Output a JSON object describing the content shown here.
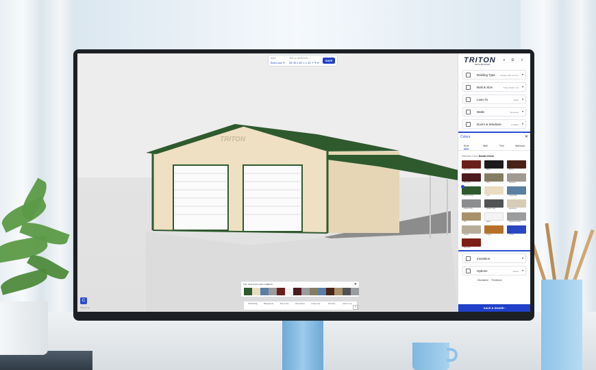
{
  "app": {
    "logo": "TRITON",
    "logo_sub": "METAL BUILDINGS",
    "side_icons": "⏸ ⚙ ⇪"
  },
  "topbar": {
    "style_label": "Style",
    "style_value": "Bolt-Lock ✎",
    "size_label": "Size & Dimension",
    "size_value": "26' W x 40' L x 12' T ✎ ▾",
    "save_label": "SAVE"
  },
  "menu": [
    {
      "label": "Building Type",
      "value": "Garage with Lean-to"
    },
    {
      "label": "Built & Size",
      "value": "Triple Width x 40"
    },
    {
      "label": "Lean-To",
      "value": "Right"
    },
    {
      "label": "Walls",
      "value": "Enclosed"
    },
    {
      "label": "Doors & Windows",
      "value": "2 Added"
    }
  ],
  "colors_panel": {
    "title": "Colors",
    "tabs": [
      "Roof",
      "Wall",
      "Trim",
      "Wainscot"
    ],
    "selected_prefix": "Selected Color:",
    "selected_value": "Hunter Green",
    "swatches": [
      {
        "name": "Barn Red",
        "color": "#6b1f1a"
      },
      {
        "name": "Black",
        "color": "#1b1b1b"
      },
      {
        "name": "Brown",
        "color": "#4a2318"
      },
      {
        "name": "Burgundy",
        "color": "#4d1a1f"
      },
      {
        "name": "Clay",
        "color": "#857d63"
      },
      {
        "name": "Earthtone",
        "color": "#a09a93"
      },
      {
        "name": "Hunter Green",
        "color": "#2f5a2e"
      },
      {
        "name": "Ivory",
        "color": "#e9dcc0"
      },
      {
        "name": "Ocean Blue",
        "color": "#5a7fa3"
      },
      {
        "name": "Pewter Gray",
        "color": "#8b8d8e"
      },
      {
        "name": "Quaker Gray",
        "color": "#505253"
      },
      {
        "name": "Sandstone",
        "color": "#d6ccb8"
      },
      {
        "name": "Tan",
        "color": "#a8916a"
      },
      {
        "name": "White",
        "color": "#f4f4f4"
      },
      {
        "name": "Galvanized Gray",
        "color": "#9a9c9e"
      },
      {
        "name": "Pebble",
        "color": "#b5ad97"
      },
      {
        "name": "Copper",
        "color": "#b5712a"
      },
      {
        "name": "Cobalt",
        "color": "#2a46c0"
      },
      {
        "name": "Rust Red",
        "color": "#7d1f14"
      }
    ]
  },
  "bottom_menu": [
    {
      "label": "Insulation",
      "value": ""
    },
    {
      "label": "Options",
      "value": "Added"
    }
  ],
  "links": {
    "disclaimer": "Disclaimer",
    "feedback": "Feedback"
  },
  "save_share": "SAVE & SHARE ›",
  "palette": {
    "title": "TRY OUR POPULAR COMBOS",
    "close": "✕",
    "combos": [
      [
        "#2f5a2e",
        "#e9dcc0"
      ],
      [
        "#5a7fa3",
        "#9a9c9e"
      ],
      [
        "#6b1f1a",
        "#f4f4f4"
      ],
      [
        "#4d1a1f",
        "#9a9c9e"
      ],
      [
        "#857d63",
        "#5a7fa3"
      ],
      [
        "#4a2318",
        "#a8916a"
      ],
      [
        "#505253",
        "#9a9c9e"
      ]
    ]
  },
  "toolbar": {
    "items": [
      "3D Rotating",
      "Background",
      "Flip to Out",
      "Dimensions",
      "Frame only",
      "Full View",
      "Clear to me"
    ],
    "help": "?"
  },
  "chat": "C",
  "powered_by": "Powered by",
  "building": {
    "roof_color": "#2f5a2e",
    "wall_color": "#efe0c3",
    "watermark": "TRITON"
  }
}
